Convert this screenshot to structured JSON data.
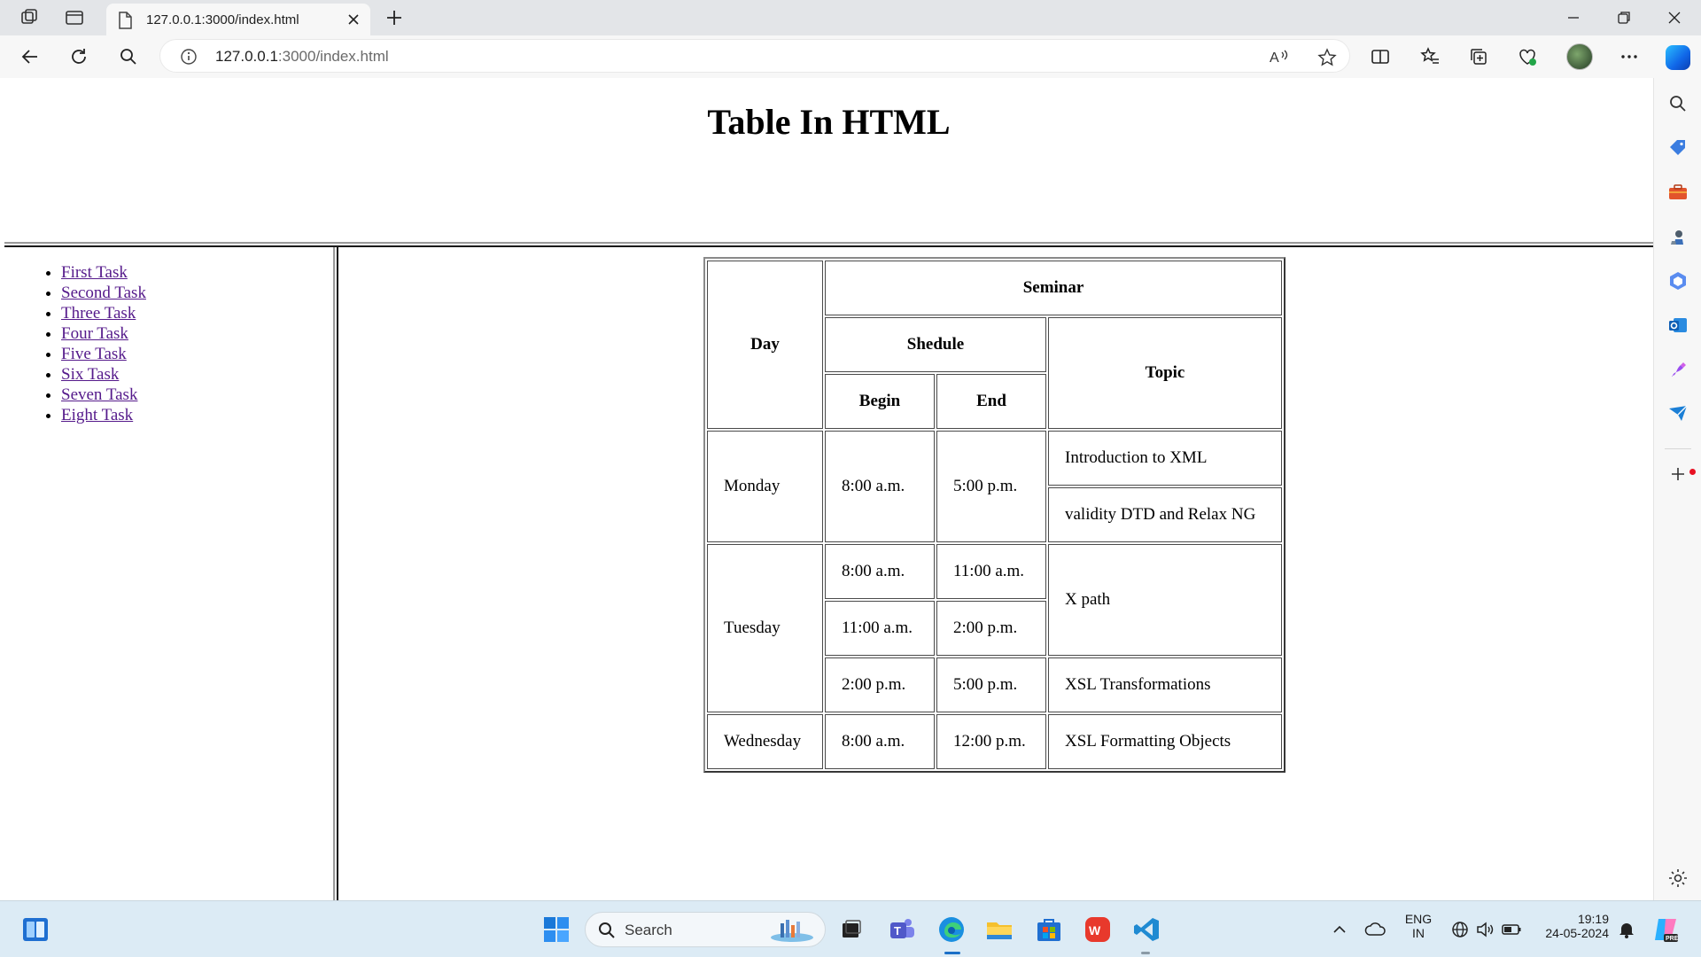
{
  "browser": {
    "tab_title": "127.0.0.1:3000/index.html",
    "url_host": "127.0.0.1",
    "url_rest": ":3000/index.html"
  },
  "page": {
    "heading": "Table In HTML",
    "menu": [
      "First Task",
      "Second Task",
      "Three Task",
      "Four Task",
      "Five Task",
      "Six Task",
      "Seven Task",
      "Eight Task"
    ],
    "table": {
      "headers": {
        "day": "Day",
        "seminar": "Seminar",
        "schedule": "Shedule",
        "topic": "Topic",
        "begin": "Begin",
        "end": "End"
      },
      "monday": {
        "day": "Monday",
        "begin": "8:00 a.m.",
        "end": "5:00 p.m.",
        "topic1": "Introduction to XML",
        "topic2": "validity DTD and Relax NG"
      },
      "tuesday": {
        "day": "Tuesday",
        "r1_begin": "8:00 a.m.",
        "r1_end": "11:00 a.m.",
        "r2_begin": "11:00 a.m.",
        "r2_end": "2:00 p.m.",
        "r3_begin": "2:00 p.m.",
        "r3_end": "5:00 p.m.",
        "topic_a": "X path",
        "topic_b": "XSL Transformations"
      },
      "wednesday": {
        "day": "Wednesday",
        "begin": "8:00 a.m.",
        "end": "12:00 p.m.",
        "topic": "XSL Formatting Objects"
      }
    }
  },
  "taskbar": {
    "search_placeholder": "Search",
    "lang_top": "ENG",
    "lang_bottom": "IN",
    "time": "19:19",
    "date": "24-05-2024"
  }
}
